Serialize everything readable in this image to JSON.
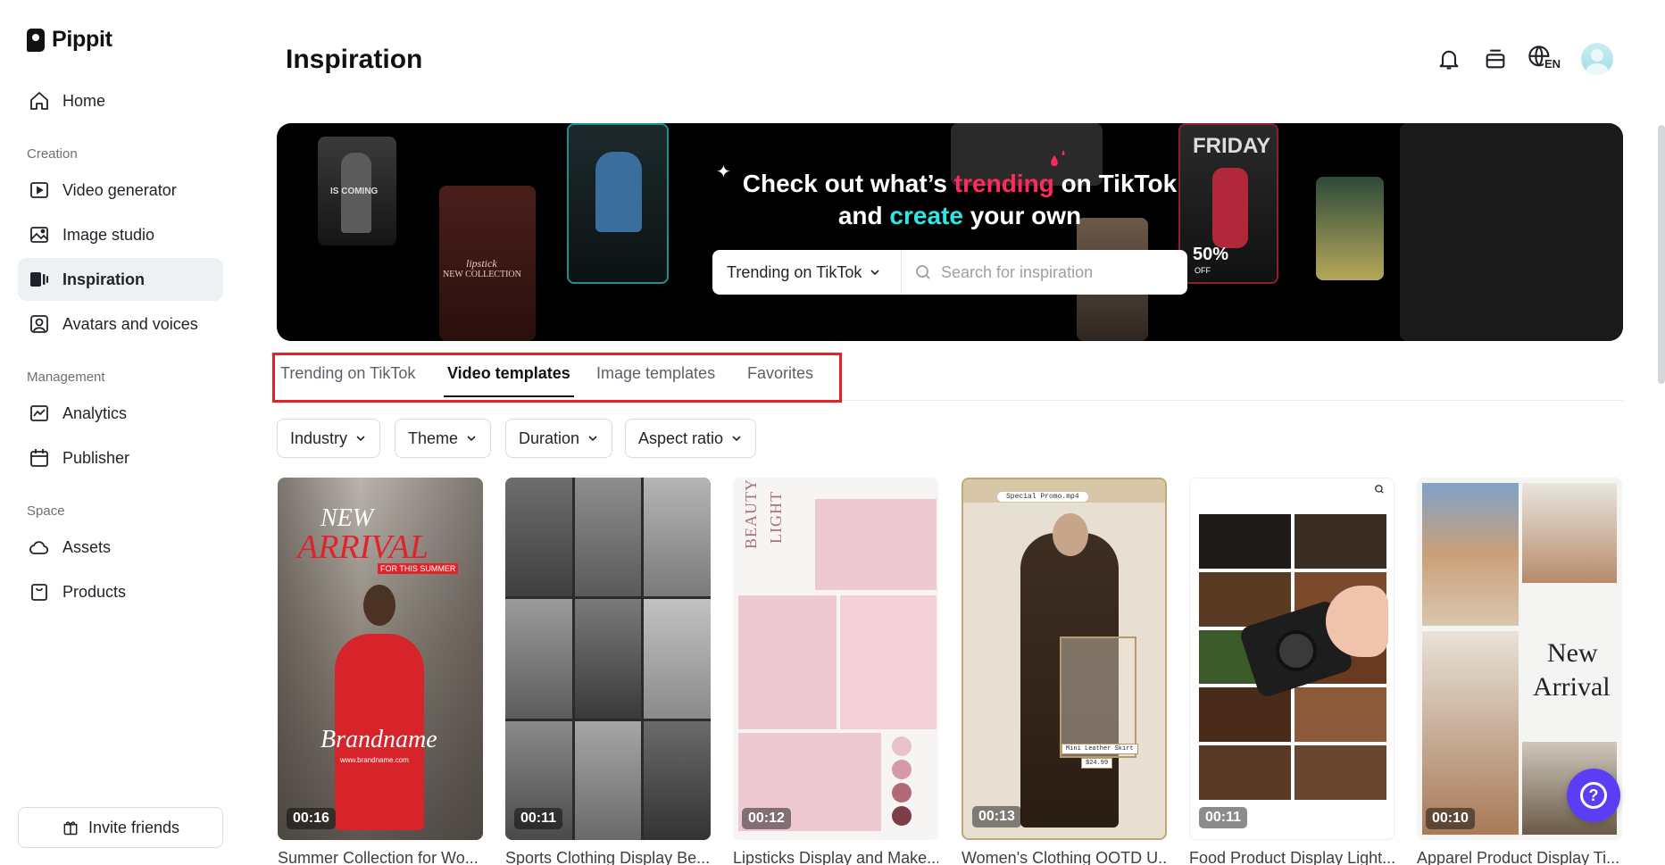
{
  "app": {
    "name": "Pippit"
  },
  "sidebar": {
    "home": "Home",
    "sections": {
      "creation": "Creation",
      "management": "Management",
      "space": "Space"
    },
    "creation_items": [
      {
        "label": "Video generator",
        "icon": "video-generator-icon"
      },
      {
        "label": "Image studio",
        "icon": "image-studio-icon"
      },
      {
        "label": "Inspiration",
        "icon": "inspiration-icon",
        "active": true
      },
      {
        "label": "Avatars and voices",
        "icon": "avatar-icon"
      }
    ],
    "management_items": [
      {
        "label": "Analytics",
        "icon": "analytics-icon"
      },
      {
        "label": "Publisher",
        "icon": "calendar-icon"
      }
    ],
    "space_items": [
      {
        "label": "Assets",
        "icon": "cloud-icon"
      },
      {
        "label": "Products",
        "icon": "bag-icon"
      }
    ],
    "invite": "Invite friends"
  },
  "header": {
    "title": "Inspiration",
    "language": "EN"
  },
  "banner": {
    "headline": {
      "part1": "Check out what’s ",
      "trending": "trending",
      "part2": " on TikTok",
      "part3": "and ",
      "create": "create",
      "part4": " your own"
    },
    "select_value": "Trending on TikTok",
    "search_placeholder": "Search for inspiration",
    "card_texts": {
      "coming": "IS COMING",
      "lipstick": "lipstick",
      "collection": "NEW COLLECTION",
      "friday": "FRIDAY",
      "sale": "50%",
      "off": "OFF"
    }
  },
  "tabs": [
    {
      "label": "Trending on TikTok",
      "active": false
    },
    {
      "label": "Video templates",
      "active": true
    },
    {
      "label": "Image templates",
      "active": false
    },
    {
      "label": "Favorites",
      "active": false
    }
  ],
  "filters": [
    "Industry",
    "Theme",
    "Duration",
    "Aspect ratio"
  ],
  "templates": [
    {
      "title": "Summer Collection for Wo...",
      "duration": "00:16",
      "texts": {
        "new": "NEW",
        "arrival": "ARRIVAL",
        "tag": "FOR THIS SUMMER",
        "brand": "Brandname",
        "url": "www.brandname.com"
      }
    },
    {
      "title": "Sports Clothing Display Be...",
      "duration": "00:11"
    },
    {
      "title": "Lipsticks Display and Make...",
      "duration": "00:12",
      "texts": {
        "beauty": "BEAUTY",
        "light": "LIGHT"
      }
    },
    {
      "title": "Women's Clothing OOTD U...",
      "duration": "00:13",
      "texts": {
        "file": "Special Promo.mp4",
        "product": "Mini Leather Skirt",
        "price": "$24.99"
      }
    },
    {
      "title": "Food Product Display Light...",
      "duration": "00:11"
    },
    {
      "title": "Apparel Product Display Ti...",
      "duration": "00:10",
      "texts": {
        "new": "New",
        "arrival": "Arrival"
      }
    }
  ],
  "colors": {
    "accent_pink": "#ff2a5b",
    "accent_cyan": "#2ee6e6",
    "tab_highlight": "#e32228",
    "help_button": "#5b3df5"
  }
}
